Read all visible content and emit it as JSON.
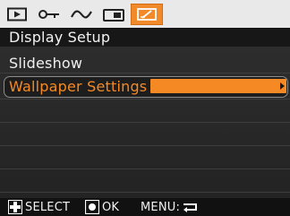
{
  "tabs": [
    {
      "icon": "playback-icon",
      "active": false
    },
    {
      "icon": "key-icon",
      "active": false
    },
    {
      "icon": "wave-icon",
      "active": false
    },
    {
      "icon": "camera-icon",
      "active": false
    },
    {
      "icon": "display-setup-icon",
      "active": true
    }
  ],
  "header": {
    "title": "Display Setup"
  },
  "menu": {
    "items": [
      {
        "label": "Slideshow"
      },
      {
        "label": "Wallpaper Settings",
        "selected": true
      }
    ]
  },
  "footer": {
    "select_label": "SELECT",
    "ok_label": "OK",
    "menu_label": "MENU:"
  },
  "colors": {
    "accent": "#f58a24",
    "tabbar": "#e9e9e9",
    "background": "#262626"
  }
}
